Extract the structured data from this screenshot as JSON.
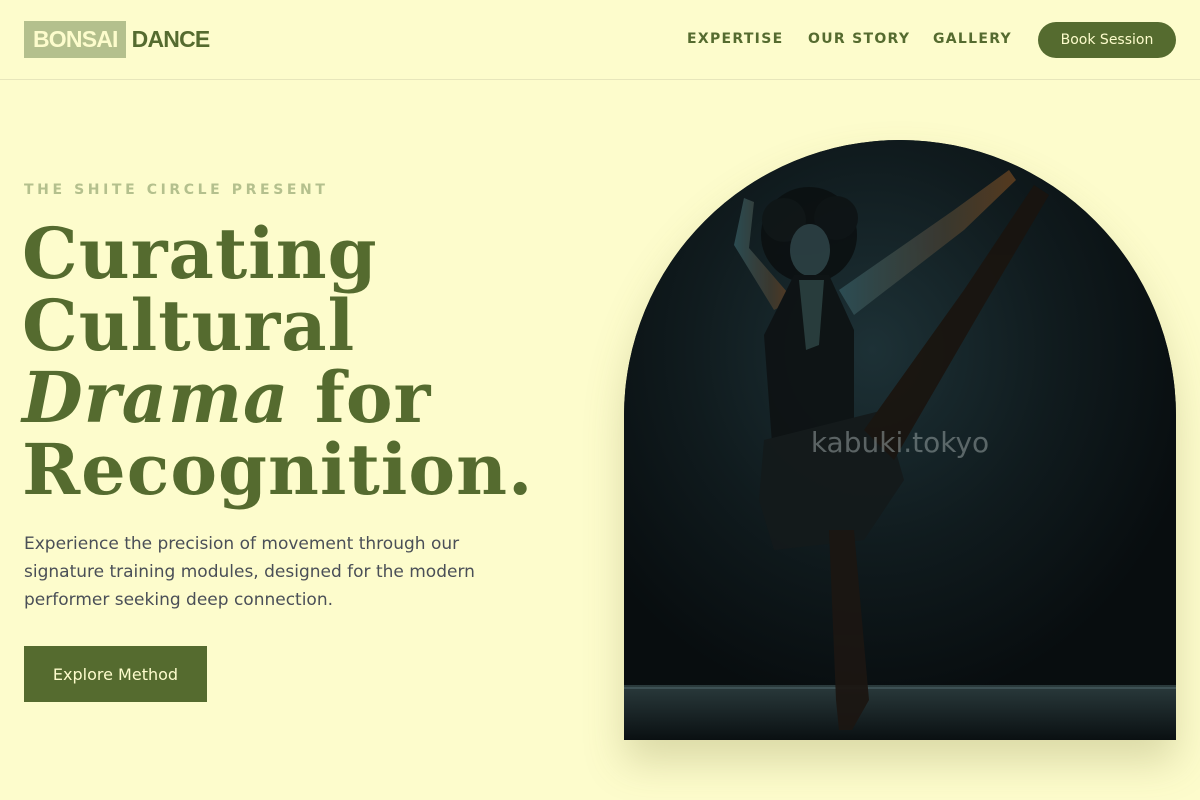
{
  "header": {
    "logo": {
      "box_text": "BONSAI",
      "word_text": "DANCE"
    },
    "nav": [
      {
        "label": "EXPERTISE"
      },
      {
        "label": "OUR STORY"
      },
      {
        "label": "GALLERY"
      }
    ],
    "cta_label": "Book Session"
  },
  "hero": {
    "eyebrow": "THE SHITE CIRCLE PRESENT",
    "headline": {
      "line1": "Curating",
      "line2": "Cultural",
      "line3_italic": "Drama",
      "line3_rest": " for",
      "line4": "Recognition."
    },
    "description": "Experience the precision of movement through our signature training modules, designed for the modern performer seeking deep connection.",
    "button_label": "Explore Method",
    "image": {
      "subject": "dancer-photo",
      "watermark": "kabuki.tokyo"
    }
  },
  "colors": {
    "background": "#fdfccc",
    "accent": "#556b2f",
    "logo_box": "#b4c08d",
    "eyebrow": "#b4c08d",
    "body_text": "#4a4f57"
  }
}
